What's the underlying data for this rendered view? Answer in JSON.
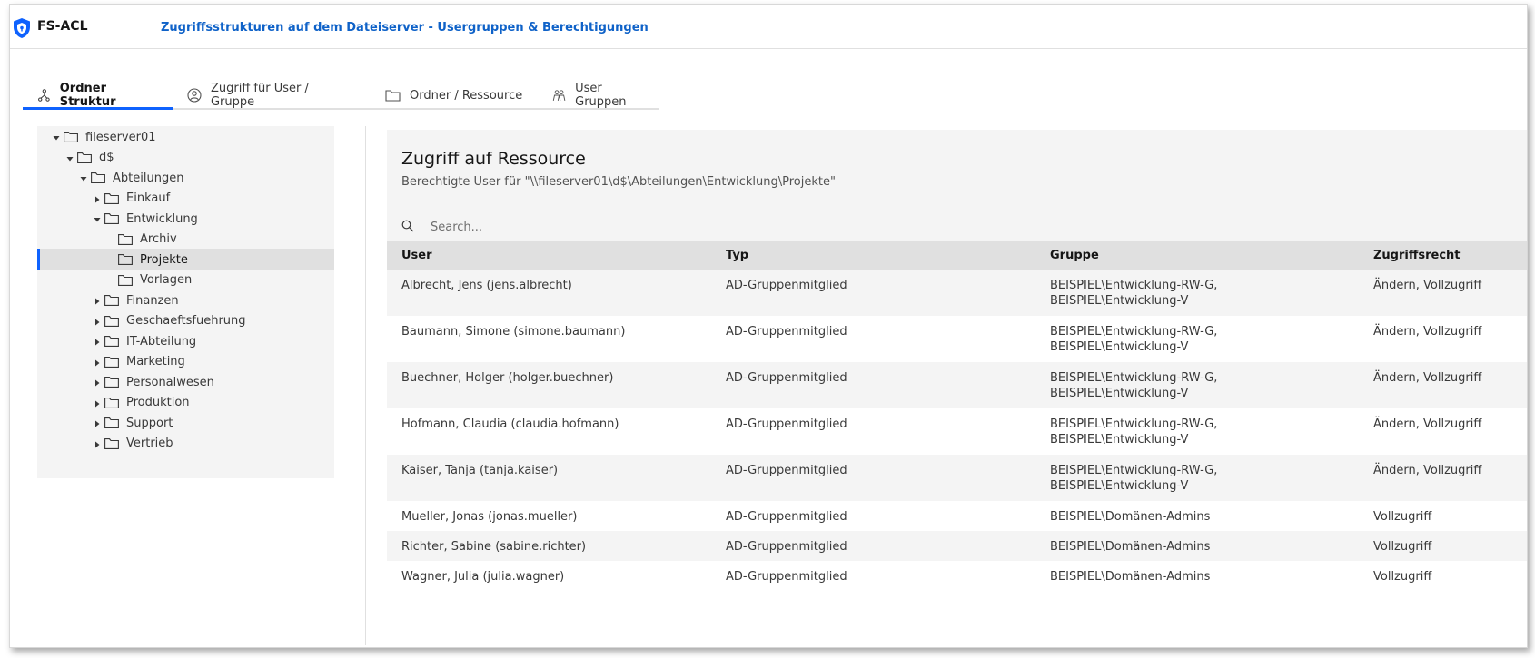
{
  "app": {
    "name": "FS-ACL",
    "title": "Zugriffsstrukturen auf dem Dateiserver - Usergruppen & Berechtigungen"
  },
  "tabs": [
    {
      "label": "Ordner Struktur",
      "icon": "tree-structure-icon",
      "active": true
    },
    {
      "label": "Zugriff für User / Gruppe",
      "icon": "user-access-icon",
      "active": false
    },
    {
      "label": "Ordner / Ressource",
      "icon": "folder-icon",
      "active": false
    },
    {
      "label": "User Gruppen",
      "icon": "user-group-icon",
      "active": false
    }
  ],
  "tree": [
    {
      "label": "fileserver01",
      "depth": 0,
      "expanded": true
    },
    {
      "label": "d$",
      "depth": 1,
      "expanded": true
    },
    {
      "label": "Abteilungen",
      "depth": 2,
      "expanded": true
    },
    {
      "label": "Einkauf",
      "depth": 3,
      "expanded": false
    },
    {
      "label": "Entwicklung",
      "depth": 3,
      "expanded": true
    },
    {
      "label": "Archiv",
      "depth": 4,
      "leaf": true
    },
    {
      "label": "Projekte",
      "depth": 4,
      "leaf": true,
      "selected": true
    },
    {
      "label": "Vorlagen",
      "depth": 4,
      "leaf": true
    },
    {
      "label": "Finanzen",
      "depth": 3,
      "expanded": false
    },
    {
      "label": "Geschaeftsfuehrung",
      "depth": 3,
      "expanded": false
    },
    {
      "label": "IT-Abteilung",
      "depth": 3,
      "expanded": false
    },
    {
      "label": "Marketing",
      "depth": 3,
      "expanded": false
    },
    {
      "label": "Personalwesen",
      "depth": 3,
      "expanded": false
    },
    {
      "label": "Produktion",
      "depth": 3,
      "expanded": false
    },
    {
      "label": "Support",
      "depth": 3,
      "expanded": false
    },
    {
      "label": "Vertrieb",
      "depth": 3,
      "expanded": false
    }
  ],
  "panel": {
    "title": "Zugriff auf Ressource",
    "subtitle": "Berechtigte User für \"\\\\fileserver01\\d$\\Abteilungen\\Entwicklung\\Projekte\"",
    "search_placeholder": "Search..."
  },
  "table": {
    "columns": [
      "User",
      "Typ",
      "Gruppe",
      "Zugriffsrecht"
    ],
    "rows": [
      [
        "Albrecht, Jens (jens.albrecht)",
        "AD-Gruppenmitglied",
        "BEISPIEL\\Entwicklung-RW-G,\nBEISPIEL\\Entwicklung-V",
        "Ändern, Vollzugriff"
      ],
      [
        "Baumann, Simone (simone.baumann)",
        "AD-Gruppenmitglied",
        "BEISPIEL\\Entwicklung-RW-G,\nBEISPIEL\\Entwicklung-V",
        "Ändern, Vollzugriff"
      ],
      [
        "Buechner, Holger (holger.buechner)",
        "AD-Gruppenmitglied",
        "BEISPIEL\\Entwicklung-RW-G,\nBEISPIEL\\Entwicklung-V",
        "Ändern, Vollzugriff"
      ],
      [
        "Hofmann, Claudia (claudia.hofmann)",
        "AD-Gruppenmitglied",
        "BEISPIEL\\Entwicklung-RW-G,\nBEISPIEL\\Entwicklung-V",
        "Ändern, Vollzugriff"
      ],
      [
        "Kaiser, Tanja (tanja.kaiser)",
        "AD-Gruppenmitglied",
        "BEISPIEL\\Entwicklung-RW-G,\nBEISPIEL\\Entwicklung-V",
        "Ändern, Vollzugriff"
      ],
      [
        "Mueller, Jonas (jonas.mueller)",
        "AD-Gruppenmitglied",
        "BEISPIEL\\Domänen-Admins",
        "Vollzugriff"
      ],
      [
        "Richter, Sabine (sabine.richter)",
        "AD-Gruppenmitglied",
        "BEISPIEL\\Domänen-Admins",
        "Vollzugriff"
      ],
      [
        "Wagner, Julia (julia.wagner)",
        "AD-Gruppenmitglied",
        "BEISPIEL\\Domänen-Admins",
        "Vollzugriff"
      ]
    ]
  },
  "colors": {
    "accent": "#0f62fe",
    "title_blue": "#0f62c8",
    "logo_blue": "#0f62fe"
  }
}
